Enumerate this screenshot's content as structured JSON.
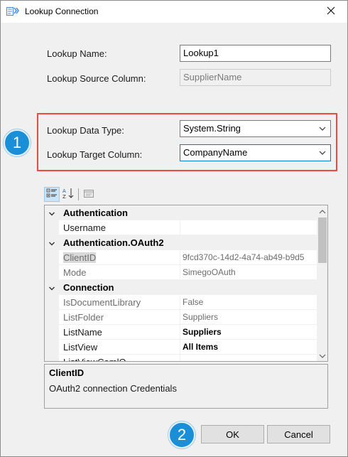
{
  "window": {
    "title": "Lookup Connection",
    "icon": "app-icon",
    "close_icon": "close-icon"
  },
  "form": {
    "lookup_name_label": "Lookup Name:",
    "lookup_name_value": "Lookup1",
    "lookup_source_column_label": "Lookup Source Column:",
    "lookup_source_column_value": "SupplierName",
    "lookup_data_type_label": "Lookup Data Type:",
    "lookup_data_type_value": "System.String",
    "lookup_target_column_label": "Lookup Target Column:",
    "lookup_target_column_value": "CompanyName"
  },
  "badges": {
    "one": "1",
    "two": "2",
    "color": "#1a8fd8"
  },
  "highlight_color": "#e84c3d",
  "toolbar": {
    "categorized_icon": "categorized-icon",
    "alphabetical_icon": "alphabetical-sort-icon",
    "property_pages_icon": "property-pages-icon"
  },
  "property_grid": {
    "rows": [
      {
        "type": "category",
        "name": "Authentication",
        "value": ""
      },
      {
        "type": "property",
        "name": "Username",
        "value": "",
        "readonly": false,
        "bold": false
      },
      {
        "type": "category",
        "name": "Authentication.OAuth2",
        "value": ""
      },
      {
        "type": "property",
        "name": "ClientID",
        "value": "9fcd370c-14d2-4a74-ab49-b9d5",
        "readonly": true,
        "bold": false
      },
      {
        "type": "property",
        "name": "Mode",
        "value": "SimegoOAuth",
        "readonly": true,
        "bold": false
      },
      {
        "type": "category",
        "name": "Connection",
        "value": ""
      },
      {
        "type": "property",
        "name": "IsDocumentLibrary",
        "value": "False",
        "readonly": true,
        "bold": false
      },
      {
        "type": "property",
        "name": "ListFolder",
        "value": "Suppliers",
        "readonly": true,
        "bold": false
      },
      {
        "type": "property",
        "name": "ListName",
        "value": "Suppliers",
        "readonly": false,
        "bold": true
      },
      {
        "type": "property",
        "name": "ListView",
        "value": "All Items",
        "readonly": false,
        "bold": true
      },
      {
        "type": "property",
        "name": "ListViewCamlQ",
        "value": "",
        "readonly": false,
        "bold": false
      }
    ]
  },
  "description": {
    "title": "ClientID",
    "text": "OAuth2 connection Credentials"
  },
  "buttons": {
    "ok": "OK",
    "cancel": "Cancel"
  }
}
